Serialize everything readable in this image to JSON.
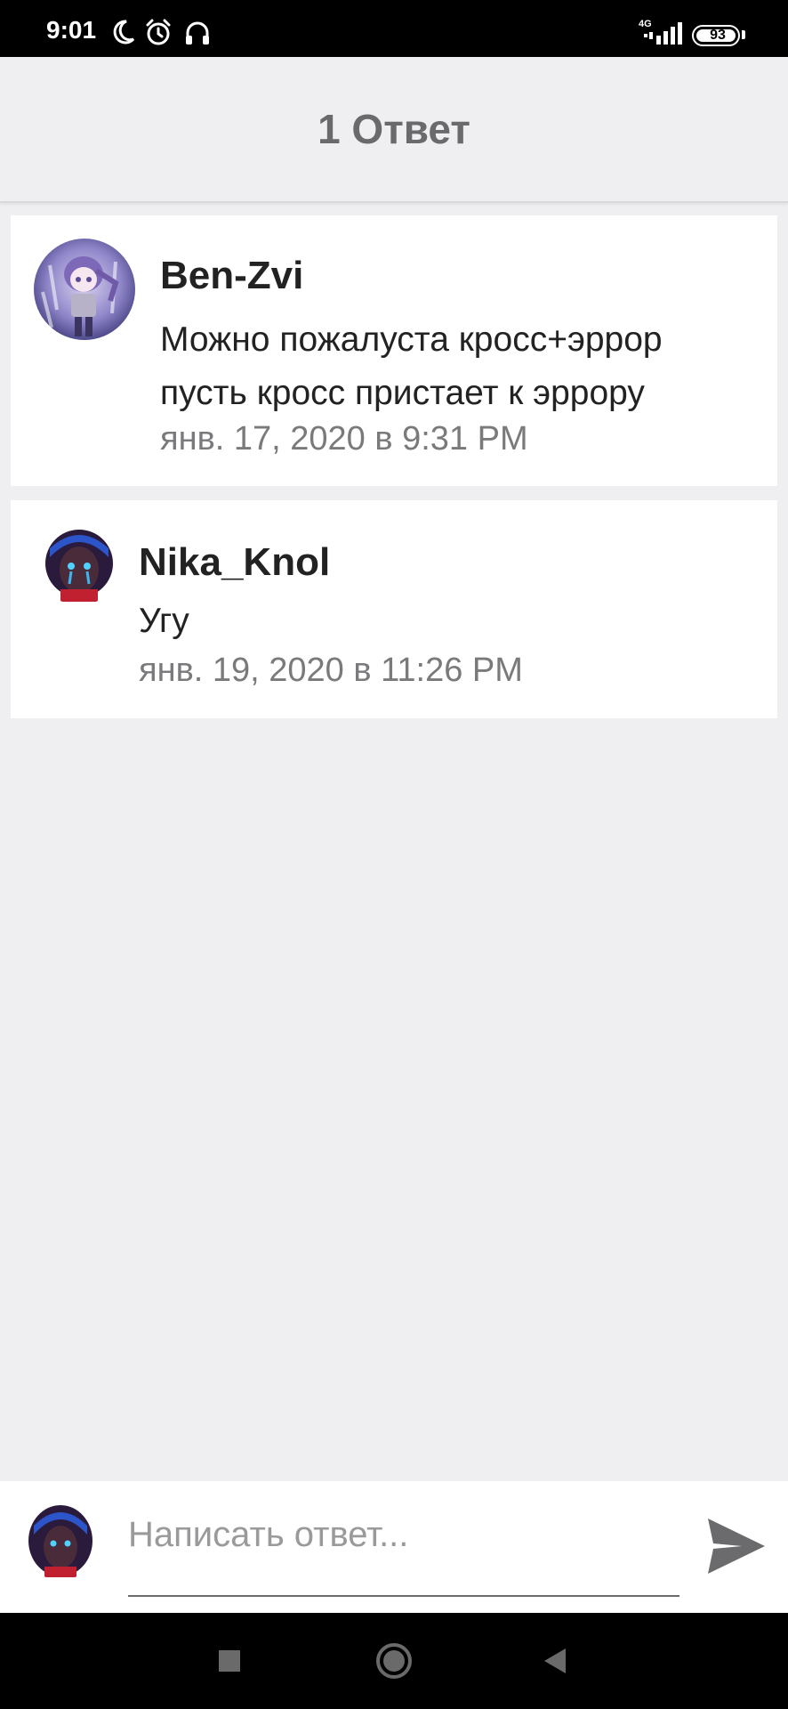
{
  "status_bar": {
    "time": "9:01",
    "network": "4G",
    "battery": "93",
    "icons": [
      "moon-icon",
      "alarm-icon",
      "headphones-icon",
      "signal-icon",
      "battery-icon"
    ]
  },
  "header": {
    "title": "1 Ответ"
  },
  "comments": [
    {
      "username": "Ben-Zvi",
      "text_line1": "Можно пожалуста кросс+эррор",
      "text_line2": "пусть кросс пристает к эррору",
      "timestamp": "янв. 17, 2020 в 9:31 PM"
    },
    {
      "username": "Nika_Knol",
      "text_line1": "Угу",
      "timestamp": "янв. 19, 2020 в 11:26 PM"
    }
  ],
  "reply": {
    "placeholder": "Написать ответ...",
    "value": ""
  },
  "nav": {
    "icons": [
      "recents-square-icon",
      "home-circle-icon",
      "back-triangle-icon"
    ]
  },
  "colors": {
    "background": "#efeef1",
    "card": "#ffffff",
    "title": "#6a6a6c",
    "timestamp": "#7a7a7c",
    "send": "#6b6b6d"
  }
}
